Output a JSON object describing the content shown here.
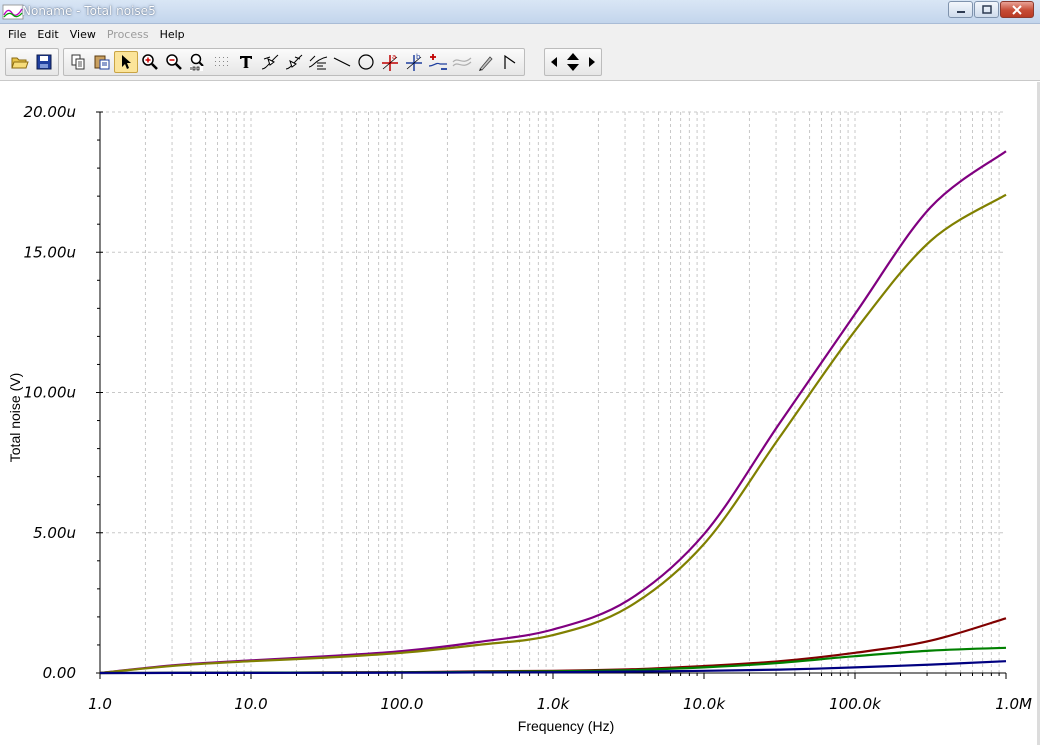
{
  "window": {
    "title": "Noname - Total noise5",
    "icons": {
      "app": "waveform-app-icon",
      "minimize": "minimize-icon",
      "maximize": "maximize-icon",
      "close": "close-icon"
    }
  },
  "menu": {
    "items": [
      {
        "label": "File",
        "disabled": false
      },
      {
        "label": "Edit",
        "disabled": false
      },
      {
        "label": "View",
        "disabled": false
      },
      {
        "label": "Process",
        "disabled": true
      },
      {
        "label": "Help",
        "disabled": false
      }
    ]
  },
  "toolbar": {
    "groups": [
      [
        "open-folder-icon",
        "save-disk-icon"
      ],
      [
        "copy-icon",
        "paste-icon",
        "pointer-arrow-icon",
        "zoom-in-icon",
        "zoom-out-icon",
        "zoom-100-icon",
        "grid-dots-icon",
        "text-tool-icon",
        "curve-marker-icon",
        "curve-marker-2-icon",
        "curve-label-icon",
        "line-tool-icon",
        "circle-tool-icon",
        "cursor-a-icon",
        "cursor-b-icon",
        "add-curve-icon",
        "remove-curve-icon",
        "pen-tool-icon",
        "arrow-tool-icon"
      ],
      [
        "scroll-left-icon",
        "scroll-up-down-icon",
        "scroll-right-icon"
      ]
    ],
    "active": "pointer-arrow-icon",
    "disabled": [
      "remove-curve-icon"
    ]
  },
  "chart_data": {
    "type": "line",
    "title": "",
    "xlabel": "Frequency (Hz)",
    "ylabel": "Total noise (V)",
    "x_scale": "log",
    "xlim": [
      1,
      1000000
    ],
    "ylim": [
      0,
      20
    ],
    "x_ticks": [
      {
        "value": 1,
        "label": "1.0"
      },
      {
        "value": 10,
        "label": "10.0"
      },
      {
        "value": 100,
        "label": "100.0"
      },
      {
        "value": 1000,
        "label": "1.0k"
      },
      {
        "value": 10000,
        "label": "10.0k"
      },
      {
        "value": 100000,
        "label": "100.0k"
      },
      {
        "value": 1000000,
        "label": "1.0M"
      }
    ],
    "y_ticks": [
      {
        "value": 0,
        "label": "0.00"
      },
      {
        "value": 5,
        "label": "5.00u"
      },
      {
        "value": 10,
        "label": "10.00u"
      },
      {
        "value": 15,
        "label": "15.00u"
      },
      {
        "value": 20,
        "label": "20.00u"
      }
    ],
    "grid": true,
    "legend": "none",
    "x": [
      1,
      3.16,
      10,
      31.6,
      100,
      316,
      1000,
      3162,
      10000,
      31623,
      100000,
      316228,
      1000000
    ],
    "series": [
      {
        "color": "#800080",
        "values": [
          0,
          0.28,
          0.45,
          0.6,
          0.78,
          1.1,
          1.55,
          2.6,
          4.95,
          8.9,
          12.8,
          16.6,
          18.6
        ]
      },
      {
        "color": "#808000",
        "values": [
          0,
          0.26,
          0.42,
          0.55,
          0.72,
          1.0,
          1.35,
          2.35,
          4.6,
          8.4,
          12.2,
          15.4,
          17.05
        ]
      },
      {
        "color": "#800000",
        "values": [
          0,
          0.005,
          0.01,
          0.02,
          0.03,
          0.06,
          0.08,
          0.13,
          0.25,
          0.42,
          0.72,
          1.15,
          1.95
        ]
      },
      {
        "color": "#008000",
        "values": [
          0,
          0.005,
          0.01,
          0.015,
          0.02,
          0.04,
          0.06,
          0.1,
          0.2,
          0.36,
          0.6,
          0.8,
          0.9
        ]
      },
      {
        "color": "#000080",
        "values": [
          0,
          0.002,
          0.005,
          0.008,
          0.01,
          0.02,
          0.03,
          0.05,
          0.08,
          0.12,
          0.2,
          0.3,
          0.42
        ]
      }
    ]
  }
}
